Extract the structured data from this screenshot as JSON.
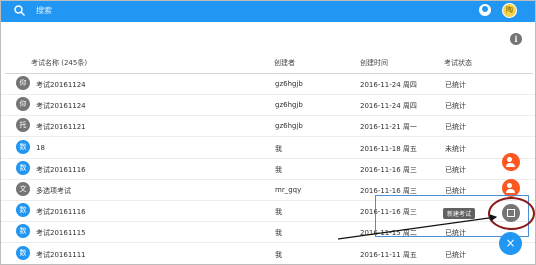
{
  "search": {
    "placeholder": "搜索"
  },
  "top": {
    "avatar_text": "陶"
  },
  "info_symbol": "i",
  "headers": [
    "考试名称 (245条)",
    "创建者",
    "创建时间",
    "考试状态"
  ],
  "rows": [
    {
      "avatar": "仰",
      "avatar_color": "#757575",
      "name": "考试20161124",
      "creator": "gz6hgjb",
      "time": "2016-11-24 周四",
      "status": "已统计"
    },
    {
      "avatar": "仰",
      "avatar_color": "#757575",
      "name": "考试20161124",
      "creator": "gz6hgjb",
      "time": "2016-11-24 周四",
      "status": "已统计"
    },
    {
      "avatar": "托",
      "avatar_color": "#757575",
      "name": "考试20161121",
      "creator": "gz6hgjb",
      "time": "2016-11-21 周一",
      "status": "已统计"
    },
    {
      "avatar": "数",
      "avatar_color": "#2196f3",
      "name": "18",
      "creator": "我",
      "time": "2016-11-18 周五",
      "status": "未统计"
    },
    {
      "avatar": "数",
      "avatar_color": "#2196f3",
      "name": "考试20161116",
      "creator": "我",
      "time": "2016-11-16 周三",
      "status": "已统计"
    },
    {
      "avatar": "文",
      "avatar_color": "#757575",
      "name": "多选项考试",
      "creator": "mr_gqy",
      "time": "2016-11-16 周三",
      "status": "已统计"
    },
    {
      "avatar": "数",
      "avatar_color": "#2196f3",
      "name": "考试20161116",
      "creator": "我",
      "time": "2016-11-16 周三",
      "status": "已统计"
    },
    {
      "avatar": "数",
      "avatar_color": "#2196f3",
      "name": "考试20161115",
      "creator": "我",
      "time": "2016-11-15 周二",
      "status": "已统计"
    },
    {
      "avatar": "数",
      "avatar_color": "#2196f3",
      "name": "考试20161111",
      "creator": "我",
      "time": "2016-11-11 周五",
      "status": "已统计"
    }
  ],
  "fab": {
    "tooltip": "新建考试",
    "main": "×"
  }
}
